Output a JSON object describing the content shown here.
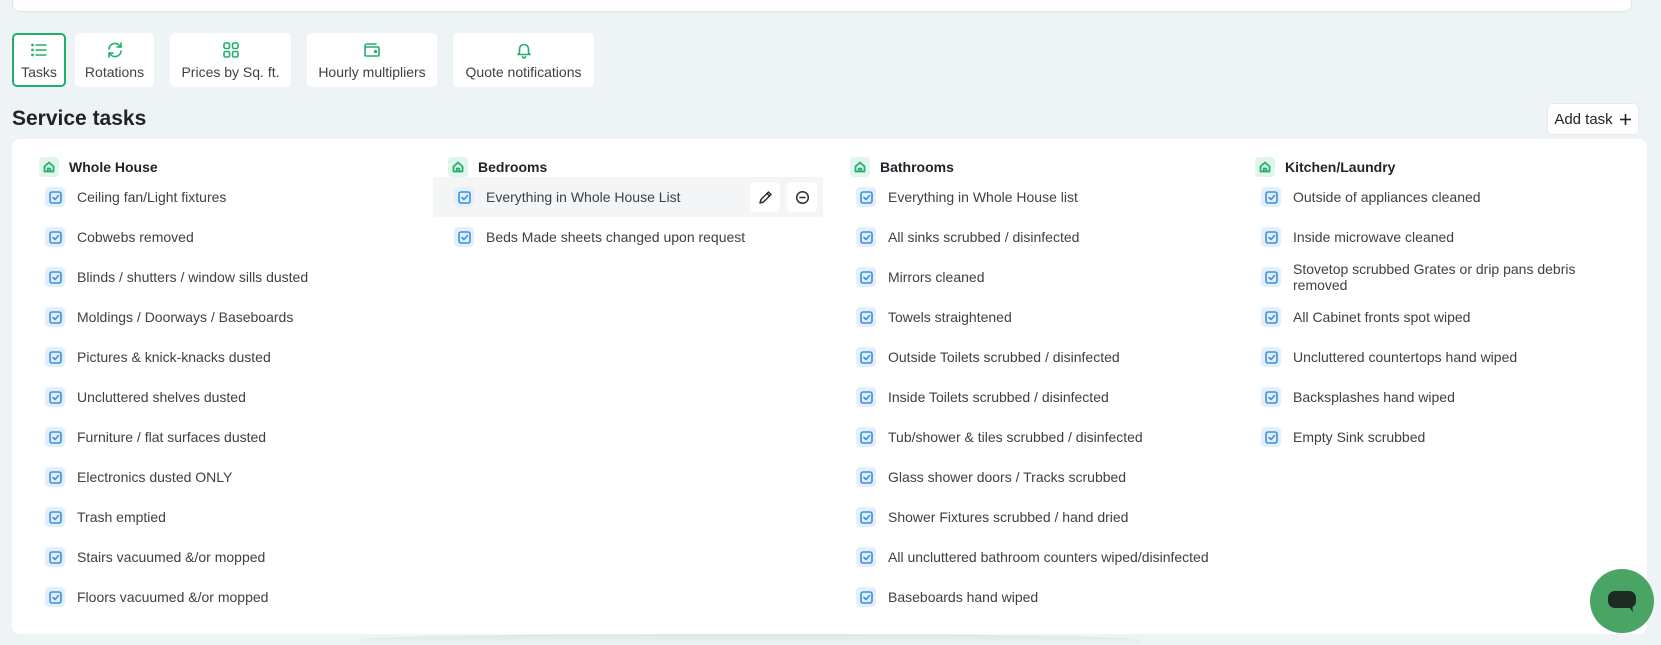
{
  "tabs": [
    {
      "label": "Tasks",
      "icon": "list-icon",
      "active": true
    },
    {
      "label": "Rotations",
      "icon": "refresh-icon",
      "active": false
    },
    {
      "label": "Prices by Sq. ft.",
      "icon": "grid-icon",
      "active": false
    },
    {
      "label": "Hourly multipliers",
      "icon": "wallet-icon",
      "active": false
    },
    {
      "label": "Quote notifications",
      "icon": "bell-icon",
      "active": false
    }
  ],
  "header": {
    "title": "Service tasks",
    "add_task_label": "Add task"
  },
  "columns": [
    {
      "title": "Whole House",
      "tasks": [
        "Ceiling fan/Light fixtures",
        "Cobwebs removed",
        "Blinds / shutters / window sills dusted",
        "Moldings / Doorways / Baseboards",
        "Pictures & knick-knacks dusted",
        "Uncluttered shelves dusted",
        "Furniture / flat surfaces dusted",
        "Electronics dusted ONLY",
        "Trash emptied",
        "Stairs vacuumed &/or mopped",
        "Floors vacuumed &/or mopped"
      ]
    },
    {
      "title": "Bedrooms",
      "tasks": [
        "Everything in Whole House List",
        "Beds Made sheets changed upon request"
      ]
    },
    {
      "title": "Bathrooms",
      "tasks": [
        "Everything in Whole House list",
        "All sinks scrubbed / disinfected",
        "Mirrors cleaned",
        "Towels straightened",
        "Outside Toilets scrubbed / disinfected",
        "Inside Toilets scrubbed / disinfected",
        "Tub/shower & tiles scrubbed / disinfected",
        "Glass shower doors / Tracks scrubbed",
        "Shower Fixtures scrubbed / hand dried",
        "All uncluttered bathroom counters wiped/disinfected",
        "Baseboards hand wiped"
      ]
    },
    {
      "title": "Kitchen/Laundry",
      "tasks": [
        "Outside of appliances cleaned",
        "Inside microwave cleaned",
        "Stovetop scrubbed Grates or drip pans debris removed",
        "All Cabinet fronts spot wiped",
        "Uncluttered countertops hand wiped",
        "Backsplashes hand wiped",
        "Empty Sink scrubbed"
      ]
    }
  ],
  "colors": {
    "accent": "#1fb06b",
    "check": "#3b8fe0",
    "chat": "#4aa564"
  }
}
